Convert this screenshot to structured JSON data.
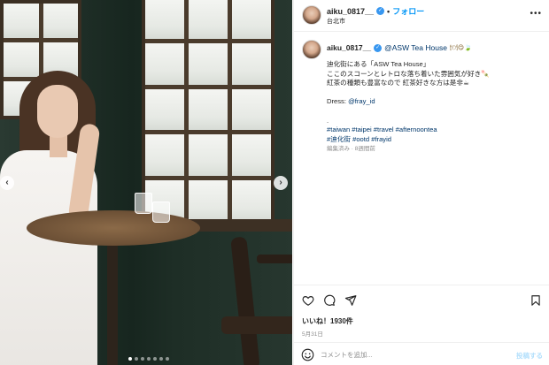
{
  "post": {
    "username": "aiku_0817__",
    "location": "台北市",
    "follow_label": "フォロー",
    "separator": "•",
    "more_label": "•••"
  },
  "caption": {
    "username": "aiku_0817__",
    "tag": "@ASW Tea House",
    "emojis": "🍽😋🍃",
    "lines": [
      "迪化街にある「ASW Tea House」",
      "ここのスコーンとレトロな落ち着いた雰囲気が好き🍡",
      "紅茶の種類も豊富なので 紅茶好きな方は是非☕"
    ],
    "dress_label": "Dress: ",
    "dress_link": "@fray_id",
    "dot": ".",
    "hashtags_line1": "#taiwan #taipei #travel #afternoontea",
    "hashtags_line2": "#迪化街 #ootd #frayid",
    "meta": "編集済み · 8週間前"
  },
  "engagement": {
    "likes": "いいね！1930件",
    "date": "5月31日"
  },
  "comment_box": {
    "placeholder": "コメントを追加...",
    "post_label": "投稿する"
  },
  "carousel": {
    "prev": "‹",
    "next": "›",
    "slides": 7,
    "active_index": 0
  },
  "colors": {
    "accent_blue": "#0095f6",
    "link_blue": "#00376b",
    "muted_gray": "#8e8e8e",
    "post_disabled": "#b2dffc",
    "verified_blue": "#3897f0"
  },
  "icons": {
    "like": "heart-icon",
    "comment": "comment-icon",
    "share": "share-icon",
    "save": "bookmark-icon",
    "emoji": "emoji-icon",
    "verified": "verified-badge-icon"
  }
}
